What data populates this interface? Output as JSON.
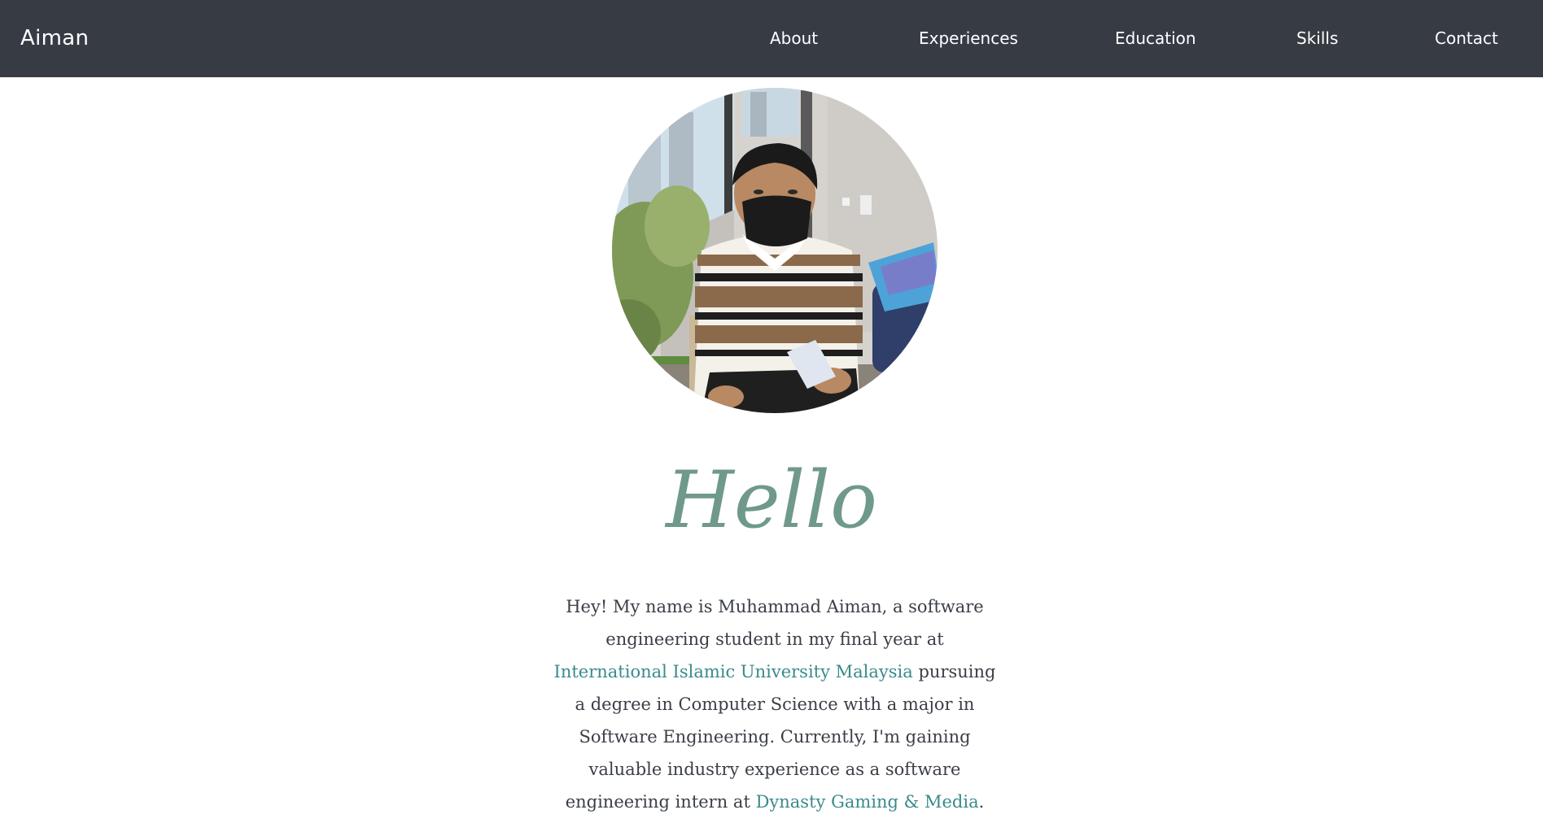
{
  "navbar": {
    "brand": "Aiman",
    "links": [
      {
        "label": "About"
      },
      {
        "label": "Experiences"
      },
      {
        "label": "Education"
      },
      {
        "label": "Skills"
      },
      {
        "label": "Contact"
      }
    ]
  },
  "hero": {
    "greeting": "Hello",
    "intro": {
      "part1": "Hey! My name is Muhammad Aiman, a software engineering student in my final year at ",
      "link1": "International Islamic University Malaysia",
      "part2": " pursuing a degree in Computer Science with a major in Software Engineering. Currently, I'm gaining valuable industry experience as a software engineering intern at ",
      "link2": "Dynasty Gaming & Media",
      "part3": "."
    }
  },
  "colors": {
    "navbar_bg": "#363b44",
    "accent_teal": "#3a8a8c",
    "greeting_green": "#6f998b",
    "body_text": "#3a3f47"
  }
}
